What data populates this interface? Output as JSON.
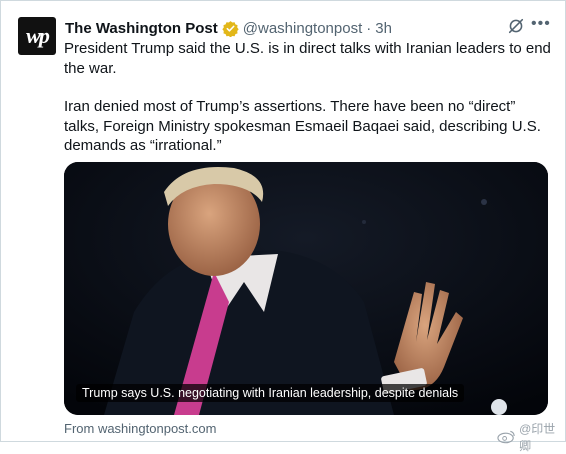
{
  "tweet": {
    "account_name": "The Washington Post",
    "handle": "@washingtonpost",
    "separator": "·",
    "time": "3h",
    "avatar_text": "wp",
    "paragraph_1": "President Trump said the U.S. is in direct talks with Iranian leaders to end the war.",
    "paragraph_2": "Iran denied most of Trump’s assertions. There have been no “direct” talks, Foreign Ministry spokesman Esmaeil Baqaei said, describing U.S. demands as “irrational.”",
    "media": {
      "caption": "Trump says U.S. negotiating with Iranian leadership, despite denials"
    },
    "source": "From washingtonpost.com"
  },
  "icons": {
    "verified": "verified-badge-icon",
    "grok": "grok-icon",
    "more": "more-icon"
  },
  "colors": {
    "verified_gold": "#e2b719",
    "secondary_text": "#536471",
    "primary_text": "#0f1419"
  },
  "watermark": {
    "text": "@印世卿"
  }
}
